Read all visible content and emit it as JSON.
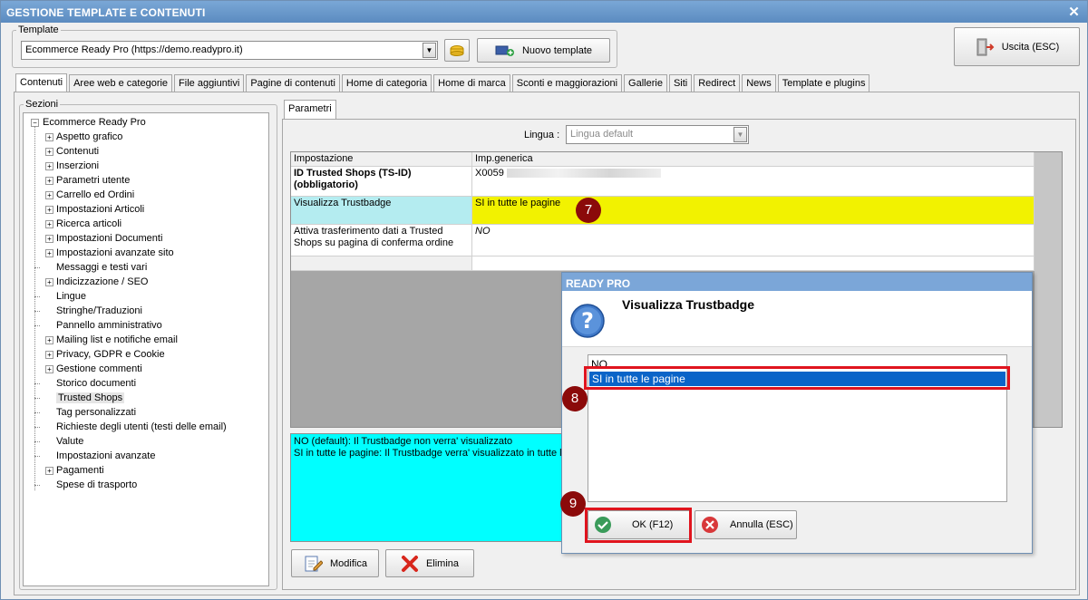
{
  "window": {
    "title": "GESTIONE TEMPLATE E CONTENUTI",
    "close": "✕"
  },
  "template": {
    "legend": "Template",
    "selected": "Ecommerce Ready Pro (https://demo.readypro.it)",
    "new_button": "Nuovo template"
  },
  "exit_button": "Uscita (ESC)",
  "tabs": [
    "Contenuti",
    "Aree web e categorie",
    "File aggiuntivi",
    "Pagine di contenuti",
    "Home di categoria",
    "Home di marca",
    "Sconti e maggiorazioni",
    "Gallerie",
    "Siti",
    "Redirect",
    "News",
    "Template e plugins"
  ],
  "sections": {
    "legend": "Sezioni",
    "root": "Ecommerce Ready Pro",
    "items": [
      {
        "label": "Aspetto grafico",
        "expandable": true
      },
      {
        "label": "Contenuti",
        "expandable": true
      },
      {
        "label": "Inserzioni",
        "expandable": true
      },
      {
        "label": "Parametri utente",
        "expandable": true
      },
      {
        "label": "Carrello ed Ordini",
        "expandable": true
      },
      {
        "label": "Impostazioni Articoli",
        "expandable": true
      },
      {
        "label": "Ricerca articoli",
        "expandable": true
      },
      {
        "label": "Impostazioni Documenti",
        "expandable": true
      },
      {
        "label": "Impostazioni avanzate sito",
        "expandable": true
      },
      {
        "label": "Messaggi e testi vari",
        "expandable": false
      },
      {
        "label": "Indicizzazione / SEO",
        "expandable": true
      },
      {
        "label": "Lingue",
        "expandable": false
      },
      {
        "label": "Stringhe/Traduzioni",
        "expandable": false
      },
      {
        "label": "Pannello amministrativo",
        "expandable": false
      },
      {
        "label": "Mailing list e notifiche email",
        "expandable": true
      },
      {
        "label": "Privacy, GDPR e Cookie",
        "expandable": true
      },
      {
        "label": "Gestione commenti",
        "expandable": true
      },
      {
        "label": "Storico documenti",
        "expandable": false
      },
      {
        "label": "Trusted Shops",
        "expandable": false,
        "selected": true
      },
      {
        "label": "Tag personalizzati",
        "expandable": false
      },
      {
        "label": "Richieste degli utenti (testi delle email)",
        "expandable": false
      },
      {
        "label": "Valute",
        "expandable": false
      },
      {
        "label": "Impostazioni avanzate",
        "expandable": false
      },
      {
        "label": "Pagamenti",
        "expandable": true
      },
      {
        "label": "Spese di trasporto",
        "expandable": false
      }
    ]
  },
  "params": {
    "tab": "Parametri",
    "lingua_label": "Lingua :",
    "lingua_value": "Lingua default",
    "col_setting": "Impostazione",
    "col_value": "Imp.generica",
    "rows": [
      {
        "setting": "ID Trusted Shops (TS-ID) (obbligatorio)",
        "value": "X0059"
      },
      {
        "setting": "Visualizza Trustbadge",
        "value": "SI in tutte le pagine"
      },
      {
        "setting": "Attiva trasferimento dati a Trusted Shops su pagina di conferma ordine",
        "value": "NO"
      }
    ],
    "description": [
      "NO (default): Il Trustbadge non verra' visualizzato",
      "SI in tutte le pagine: Il Trustbadge verra' visualizzato in tutte l"
    ],
    "edit_button": "Modifica",
    "delete_button": "Elimina"
  },
  "dialog": {
    "title": "READY PRO",
    "heading": "Visualizza Trustbadge",
    "options": [
      "NO",
      "SI in tutte le pagine"
    ],
    "ok": "OK (F12)",
    "cancel": "Annulla (ESC)"
  },
  "markers": [
    "7",
    "8",
    "9"
  ],
  "colors": {
    "titlebar": "#5b8bc0",
    "highlight_yellow": "#f2f200",
    "highlight_cyan": "#b4ecf0",
    "description_bg": "#00ffff",
    "selection_blue": "#0a64c8",
    "marker": "#8b0a0a",
    "callout_border": "#e0141e"
  }
}
